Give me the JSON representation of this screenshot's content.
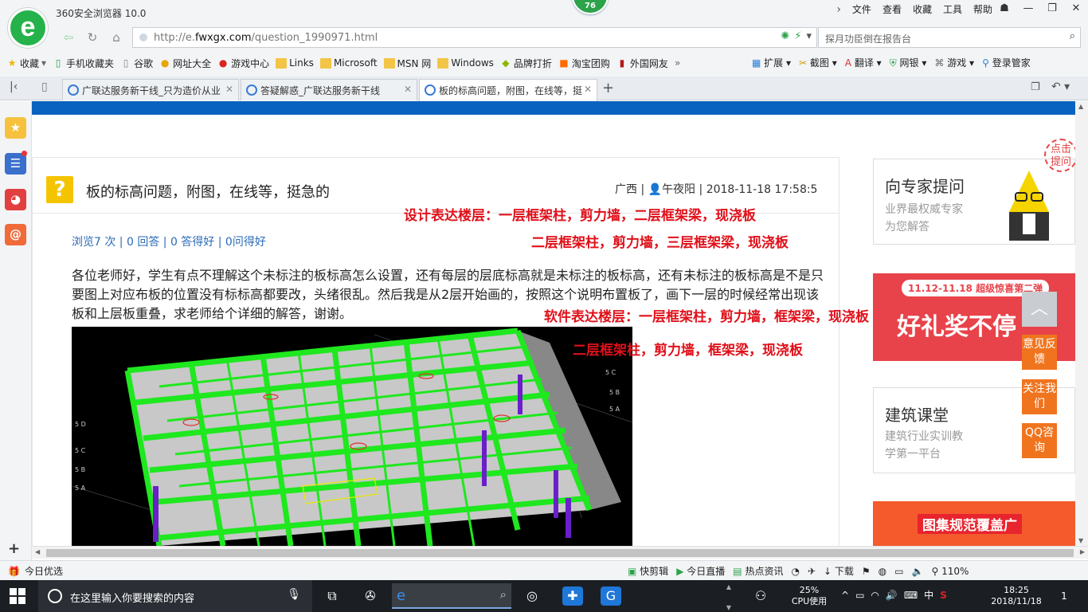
{
  "window": {
    "app_title": "360安全浏览器 10.0",
    "badge": "76",
    "menu": [
      "文件",
      "查看",
      "收藏",
      "工具",
      "帮助"
    ]
  },
  "nav": {
    "url_prefix": "http://e.",
    "url_domain": "fwxgx.com",
    "url_path": "/question_1990971.html",
    "search_placeholder": "探月功臣倒在报告台"
  },
  "bookmarks": {
    "items": [
      "收藏",
      "手机收藏夹",
      "谷歌",
      "网址大全",
      "游戏中心",
      "Links",
      "Microsoft",
      "MSN 网",
      "Windows",
      "品牌打折",
      "淘宝团购",
      "外国网友"
    ],
    "more": "»",
    "right_items": [
      "扩展",
      "截图",
      "翻译",
      "网银",
      "游戏",
      "登录管家"
    ]
  },
  "tabs": [
    {
      "label": "广联达服务新干线_只为造价从业"
    },
    {
      "label": "答疑解惑_广联达服务新干线"
    },
    {
      "label": "板的标高问题，附图，在线等，挺"
    }
  ],
  "question": {
    "title": "板的标高问题，附图，在线等，挺急的",
    "region": "广西",
    "user": "午夜阳",
    "datetime": "2018-11-18 17:58:5",
    "stats": "浏览7 次 | 0 回答 | 0 答得好 | 0问得好",
    "body": "各位老师好，学生有点不理解这个未标注的板标高怎么设置，还有每层的层底标高就是未标注的板标高，还有未标注的板标高是不是只要图上对应布板的位置没有标标高都要改，头绪很乱。然后我是从2层开始画的，按照这个说明布置板了，画下一层的时候经常出现该板和上层板重叠，求老师给个详细的解答，谢谢。"
  },
  "annotations": {
    "line1": "设计表达楼层：一层框架柱，剪力墙，二层框架梁，现浇板",
    "line2": "二层框架柱，剪力墙，三层框架梁，现浇板",
    "line3": "软件表达楼层：一层框架柱，剪力墙，框架梁，现浇板",
    "line4": "二层框架柱，剪力墙，框架梁，现浇板"
  },
  "sidebar": {
    "expert_title": "向专家提问",
    "expert_sub1": "业界最权威专家",
    "expert_sub2": "为您解答",
    "ask_bubble": "点击提问",
    "promo1_date": "11.12-11.18  超级惊喜第二弹",
    "promo1_big": "好礼奖不停",
    "course_title": "建筑课堂",
    "course_sub1": "建筑行业实训教",
    "course_sub2": "学第一平台",
    "promo2_text": "图集规范覆盖广",
    "float_feedback": "意见反馈",
    "float_follow": "关注我们",
    "float_qq": "QQ咨询"
  },
  "status": {
    "left": "今日优选",
    "items": [
      "快剪辑",
      "今日直播",
      "热点资讯",
      "下载",
      "110%"
    ]
  },
  "taskbar": {
    "search_text": "在这里输入你要搜索的内容",
    "cpu_percent": "25%",
    "cpu_label": "CPU使用",
    "ime": "中",
    "time": "18:25",
    "date": "2018/11/18",
    "notif": "1"
  },
  "colors": {
    "accent_blue": "#0a62c0",
    "annotation_red": "#e0101a",
    "brand_green": "#25b24a",
    "float_orange": "#f0741e"
  }
}
